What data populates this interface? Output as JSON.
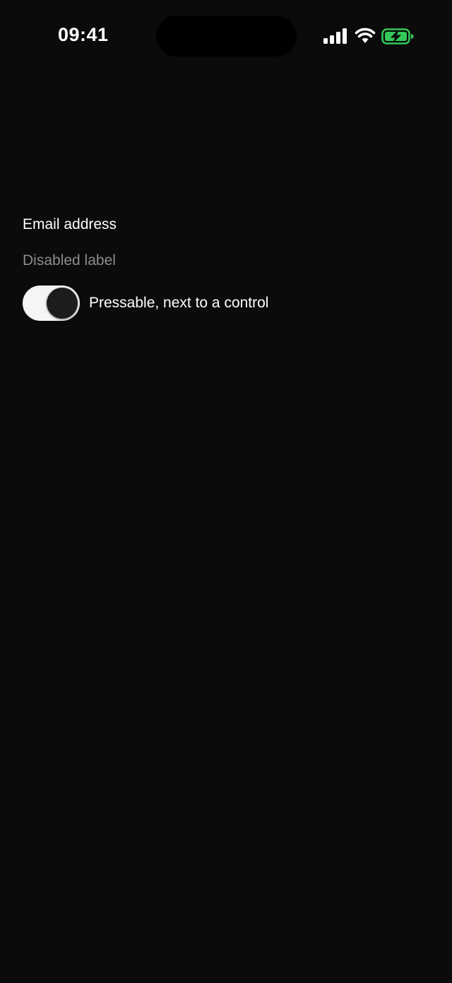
{
  "status_bar": {
    "time": "09:41",
    "icons": [
      "signal-icon",
      "wifi-icon",
      "battery-charging-icon"
    ],
    "battery_color": "#34c759"
  },
  "form": {
    "email_label": "Email address",
    "disabled_label": "Disabled label",
    "switch": {
      "label": "Pressable, next to a control",
      "checked": true
    }
  },
  "colors": {
    "background": "#0b0b0b",
    "text": "#ffffff",
    "disabled_text": "#8c8c8c",
    "switch_track": "#f5f5f5",
    "switch_knob": "#1c1c1e"
  }
}
